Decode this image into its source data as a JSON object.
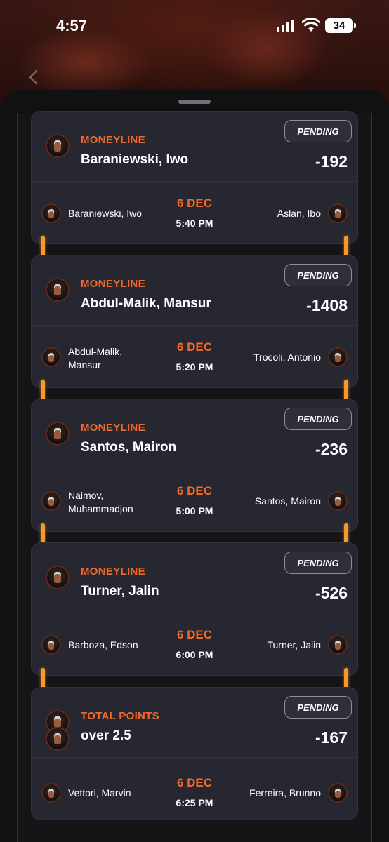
{
  "status": {
    "time": "4:57",
    "battery": "34"
  },
  "bets": [
    {
      "bet_type": "MONEYLINE",
      "selection": "Baraniewski, Iwo",
      "odds": "-192",
      "status": "PENDING",
      "fighter_left": "Baraniewski, Iwo",
      "fighter_right": "Aslan, Ibo",
      "date": "6 DEC",
      "time": "5:40 PM"
    },
    {
      "bet_type": "MONEYLINE",
      "selection": "Abdul-Malik, Mansur",
      "odds": "-1408",
      "status": "PENDING",
      "fighter_left": "Abdul-Malik, Mansur",
      "fighter_right": "Trocoli, Antonio",
      "date": "6 DEC",
      "time": "5:20 PM"
    },
    {
      "bet_type": "MONEYLINE",
      "selection": "Santos, Mairon",
      "odds": "-236",
      "status": "PENDING",
      "fighter_left": "Naimov, Muhammadjon",
      "fighter_right": "Santos, Mairon",
      "date": "6 DEC",
      "time": "5:00 PM"
    },
    {
      "bet_type": "MONEYLINE",
      "selection": "Turner, Jalin",
      "odds": "-526",
      "status": "PENDING",
      "fighter_left": "Barboza, Edson",
      "fighter_right": "Turner, Jalin",
      "date": "6 DEC",
      "time": "6:00 PM"
    },
    {
      "bet_type": "TOTAL POINTS",
      "selection": "over 2.5",
      "odds": "-167",
      "status": "PENDING",
      "fighter_left": "Vettori, Marvin",
      "fighter_right": "Ferreira, Brunno",
      "date": "6 DEC",
      "time": "6:25 PM"
    }
  ],
  "colors": {
    "accent": "#f0692a",
    "connector": "#f39a2b",
    "card_bg": "#262731"
  },
  "icons": [
    "back-chevron-icon",
    "signal-icon",
    "wifi-icon",
    "battery-icon",
    "fighter-avatar-icon"
  ]
}
